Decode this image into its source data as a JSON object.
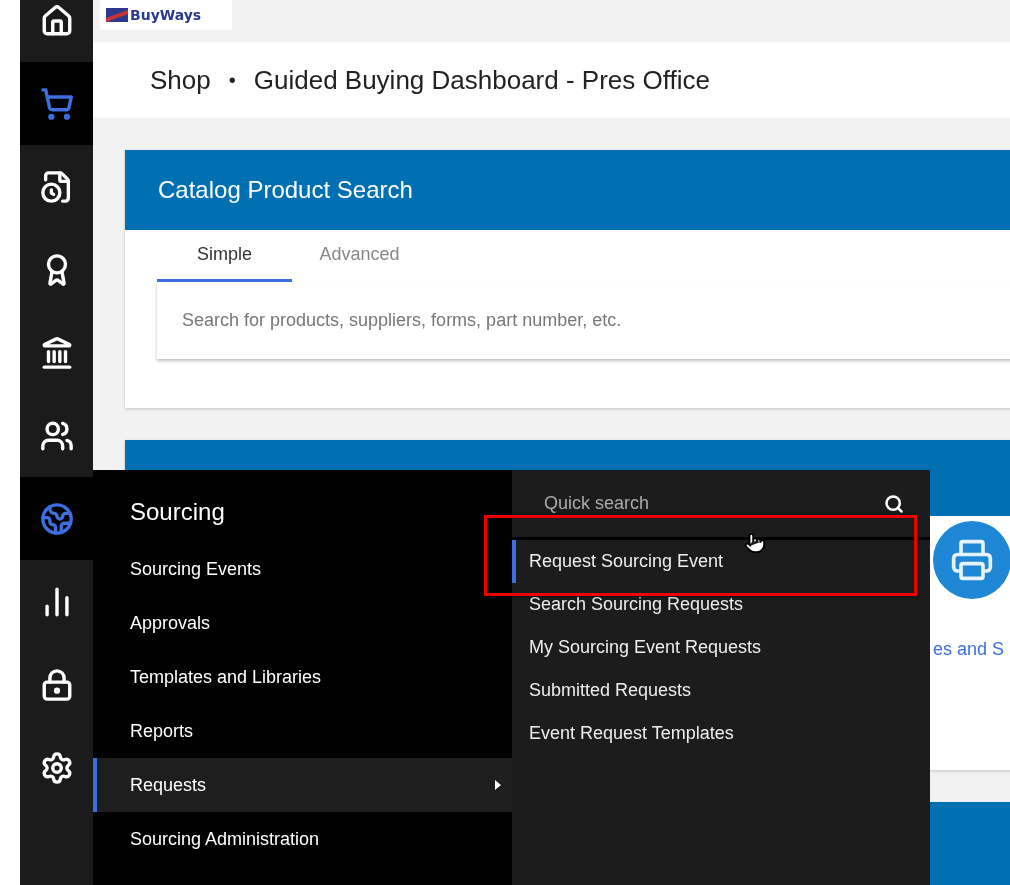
{
  "logo": {
    "text": "BuyWays"
  },
  "breadcrumb": [
    "Shop",
    "Guided Buying Dashboard - Pres Office"
  ],
  "breadcrumb_separator": "•",
  "rail": [
    {
      "kind": "home",
      "active": false
    },
    {
      "kind": "cart",
      "active": true
    },
    {
      "kind": "history",
      "active": false
    },
    {
      "kind": "award",
      "active": false
    },
    {
      "kind": "bank",
      "active": false
    },
    {
      "kind": "users",
      "active": false
    },
    {
      "kind": "globe",
      "active": true
    },
    {
      "kind": "chart",
      "active": false
    },
    {
      "kind": "lock",
      "active": false
    },
    {
      "kind": "settings",
      "active": false
    }
  ],
  "catalog_search": {
    "title": "Catalog Product Search",
    "tabs": [
      {
        "label": "Simple",
        "selected": true
      },
      {
        "label": "Advanced",
        "selected": false
      }
    ],
    "search": {
      "placeholder": "Search for products, suppliers, forms, part number, etc."
    }
  },
  "category_card": {
    "label": "es and S"
  },
  "menu": {
    "title": "Sourcing",
    "items": [
      {
        "label": "Sourcing Events",
        "selected": false,
        "has_submenu": false
      },
      {
        "label": "Approvals",
        "selected": false,
        "has_submenu": false
      },
      {
        "label": "Templates and Libraries",
        "selected": false,
        "has_submenu": false
      },
      {
        "label": "Reports",
        "selected": false,
        "has_submenu": false
      },
      {
        "label": "Requests",
        "selected": true,
        "has_submenu": true
      },
      {
        "label": "Sourcing Administration",
        "selected": false,
        "has_submenu": false
      }
    ],
    "quick_search": {
      "placeholder": "Quick search"
    },
    "submenu": [
      {
        "label": "Request Sourcing Event",
        "selected": true,
        "highlighted": true
      },
      {
        "label": "Search Sourcing Requests",
        "selected": false,
        "highlighted": false
      },
      {
        "label": "My Sourcing Event Requests",
        "selected": false,
        "highlighted": false
      },
      {
        "label": "Submitted Requests",
        "selected": false,
        "highlighted": false
      },
      {
        "label": "Event Request Templates",
        "selected": false,
        "highlighted": false
      }
    ]
  }
}
